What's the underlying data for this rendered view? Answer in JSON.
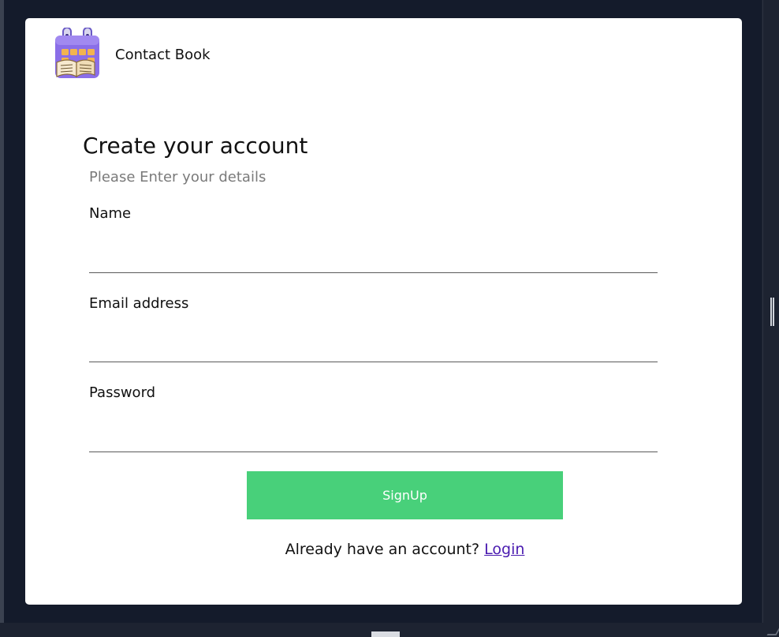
{
  "brand": {
    "name": "Contact Book",
    "logo_icon": "calendar-book-icon"
  },
  "form": {
    "title": "Create your account",
    "subtitle": "Please Enter your details",
    "fields": [
      {
        "label": "Name",
        "value": "",
        "placeholder": ""
      },
      {
        "label": "Email address",
        "value": "",
        "placeholder": ""
      },
      {
        "label": "Password",
        "value": "",
        "placeholder": ""
      }
    ],
    "submit_label": "SignUp"
  },
  "footer": {
    "prompt": "Already have an account?",
    "link_label": "Login"
  },
  "colors": {
    "background": "#141b2b",
    "card": "#ffffff",
    "button": "#48d07a",
    "link": "#4a1bb0",
    "subtitle": "#7a7a7a"
  }
}
